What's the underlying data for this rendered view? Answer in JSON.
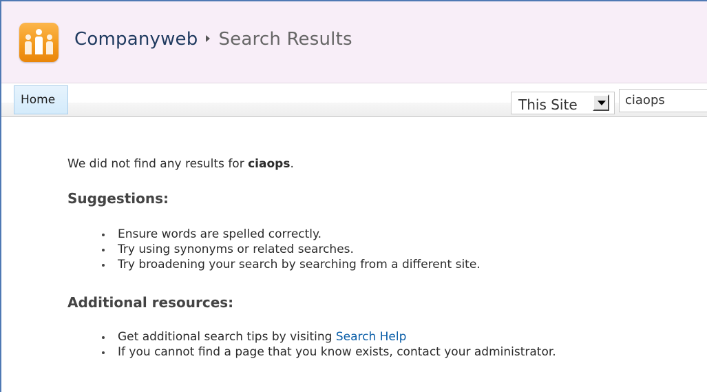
{
  "header": {
    "site_name": "Companyweb",
    "page_title": "Search Results",
    "logo_icon": "people-group-icon"
  },
  "nav": {
    "tabs": [
      {
        "label": "Home"
      }
    ]
  },
  "search": {
    "scope": "This Site",
    "query": "ciaops"
  },
  "results": {
    "no_results_prefix": "We did not find any results for",
    "query": "ciaops",
    "no_results_suffix": ".",
    "suggestions": {
      "heading": "Suggestions:",
      "items": [
        "Ensure words are spelled correctly.",
        "Try using synonyms or related searches.",
        "Try broadening your search by searching from a different site."
      ]
    },
    "resources": {
      "heading": "Additional resources:",
      "tips_prefix": "Get additional search tips by visiting",
      "tips_link": "Search Help",
      "contact": "If you cannot find a page that you know exists, contact your administrator."
    }
  },
  "colors": {
    "title_bg": "#f8eef8",
    "logo_orange": "#f39a1c",
    "link_blue": "#0a5ea8",
    "tab_bg": "#d4ebfb",
    "frame_border": "#4f79b4"
  }
}
